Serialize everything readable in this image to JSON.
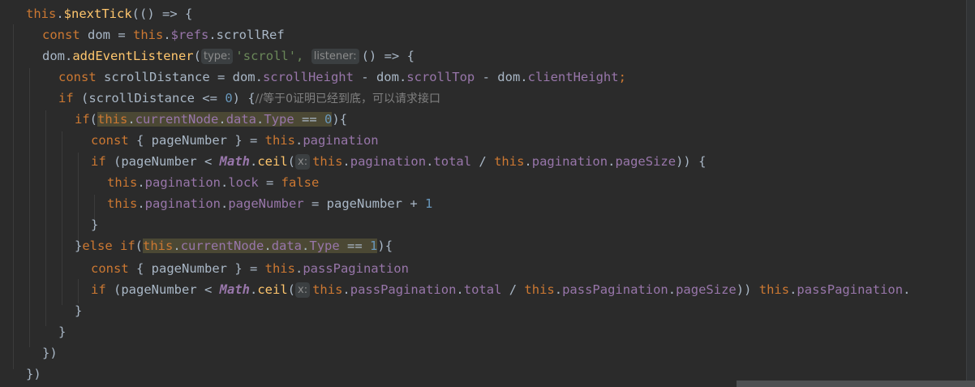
{
  "code": {
    "l1": {
      "a": "this",
      "b": ".",
      "c": "$nextTick",
      "d": "(() => {"
    },
    "l2": {
      "a": "const ",
      "b": "dom = ",
      "c": "this",
      "d": ".",
      "e": "$refs",
      "f": ".scrollRef"
    },
    "l3": {
      "a": "dom.",
      "b": "addEventListener",
      "c": "(",
      "hint_type": "type:",
      "str": "'scroll',",
      "hint_listener": "listener:",
      "d": "() => {"
    },
    "l4": {
      "a": "const ",
      "b": "scrollDistance = dom.",
      "c": "scrollHeight",
      "d": " - dom.",
      "e": "scrollTop",
      "f": " - dom.",
      "g": "clientHeight",
      "h": ";"
    },
    "l5": {
      "a": "if ",
      "b": "(scrollDistance <= ",
      "c": "0",
      "d": ") {",
      "e": "//等于0证明已经到底，可以请求接口"
    },
    "l6": {
      "a": "if",
      "b": "(",
      "c": "this",
      "d": ".",
      "e": "currentNode",
      "f": ".",
      "g": "data",
      "h": ".",
      "i": "Type",
      "j": " == ",
      "k": "0",
      "l": "){"
    },
    "l7": {
      "a": "const ",
      "b": "{ pageNumber } = ",
      "c": "this",
      "d": ".",
      "e": "pagination"
    },
    "l8": {
      "a": "if ",
      "b": "(pageNumber < ",
      "c": "Math",
      "d": ".",
      "e": "ceil",
      "f": "(",
      "hint_x": "x:",
      "g": "this",
      "h": ".",
      "i": "pagination",
      "j": ".",
      "k": "total",
      "l": " / ",
      "m": "this",
      "n": ".",
      "o": "pagination",
      "p": ".",
      "q": "pageSize",
      "r": ")) {"
    },
    "l9": {
      "a": "this",
      "b": ".",
      "c": "pagination",
      "d": ".",
      "e": "lock",
      "f": " = ",
      "g": "false"
    },
    "l10": {
      "a": "this",
      "b": ".",
      "c": "pagination",
      "d": ".",
      "e": "pageNumber",
      "f": " = pageNumber + ",
      "g": "1"
    },
    "l11": {
      "a": "}"
    },
    "l12": {
      "a": "}",
      "b": "else if",
      "c": "(",
      "d": "this",
      "e": ".",
      "f": "currentNode",
      "g": ".",
      "h": "data",
      "i": ".",
      "j": "Type",
      "k": " == ",
      "l": "1",
      "m": "){"
    },
    "l13": {
      "a": "const ",
      "b": "{ pageNumber } = ",
      "c": "this",
      "d": ".",
      "e": "passPagination"
    },
    "l14": {
      "a": "if ",
      "b": "(pageNumber < ",
      "c": "Math",
      "d": ".",
      "e": "ceil",
      "f": "(",
      "hint_x": "x:",
      "g": "this",
      "h": ".",
      "i": "passPagination",
      "j": ".",
      "k": "total",
      "l": " / ",
      "m": "this",
      "n": ".",
      "o": "passPagination",
      "p": ".",
      "q": "pageSize",
      "r": ")) ",
      "s": "this",
      "t": ".",
      "u": "passPagination",
      "v": "."
    },
    "l15": {
      "a": "}"
    },
    "l16": {
      "a": "}"
    },
    "l17": {
      "a": "})"
    },
    "l18": {
      "a": "})"
    }
  },
  "colors": {
    "background": "#2b2b2b",
    "keyword": "#cc7832",
    "property": "#9876aa",
    "string": "#6a8759",
    "number": "#6897bb",
    "function": "#ffc66d",
    "comment": "#808080",
    "highlight": "#4b4834"
  }
}
